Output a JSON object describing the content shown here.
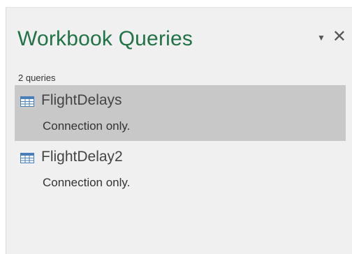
{
  "pane": {
    "title": "Workbook Queries",
    "menu_icon": "dropdown-caret-icon",
    "close_icon": "close-icon",
    "query_count_text": "2 queries"
  },
  "queries": [
    {
      "name": "FlightDelays",
      "status": "Connection only.",
      "selected": true,
      "icon": "table-icon"
    },
    {
      "name": "FlightDelay2",
      "status": "Connection only.",
      "selected": false,
      "icon": "table-icon"
    }
  ],
  "colors": {
    "title": "#217346",
    "pane_background": "#f0f0f0",
    "selected_background": "#c8c8c8",
    "icon_header": "#4a7ebb"
  }
}
